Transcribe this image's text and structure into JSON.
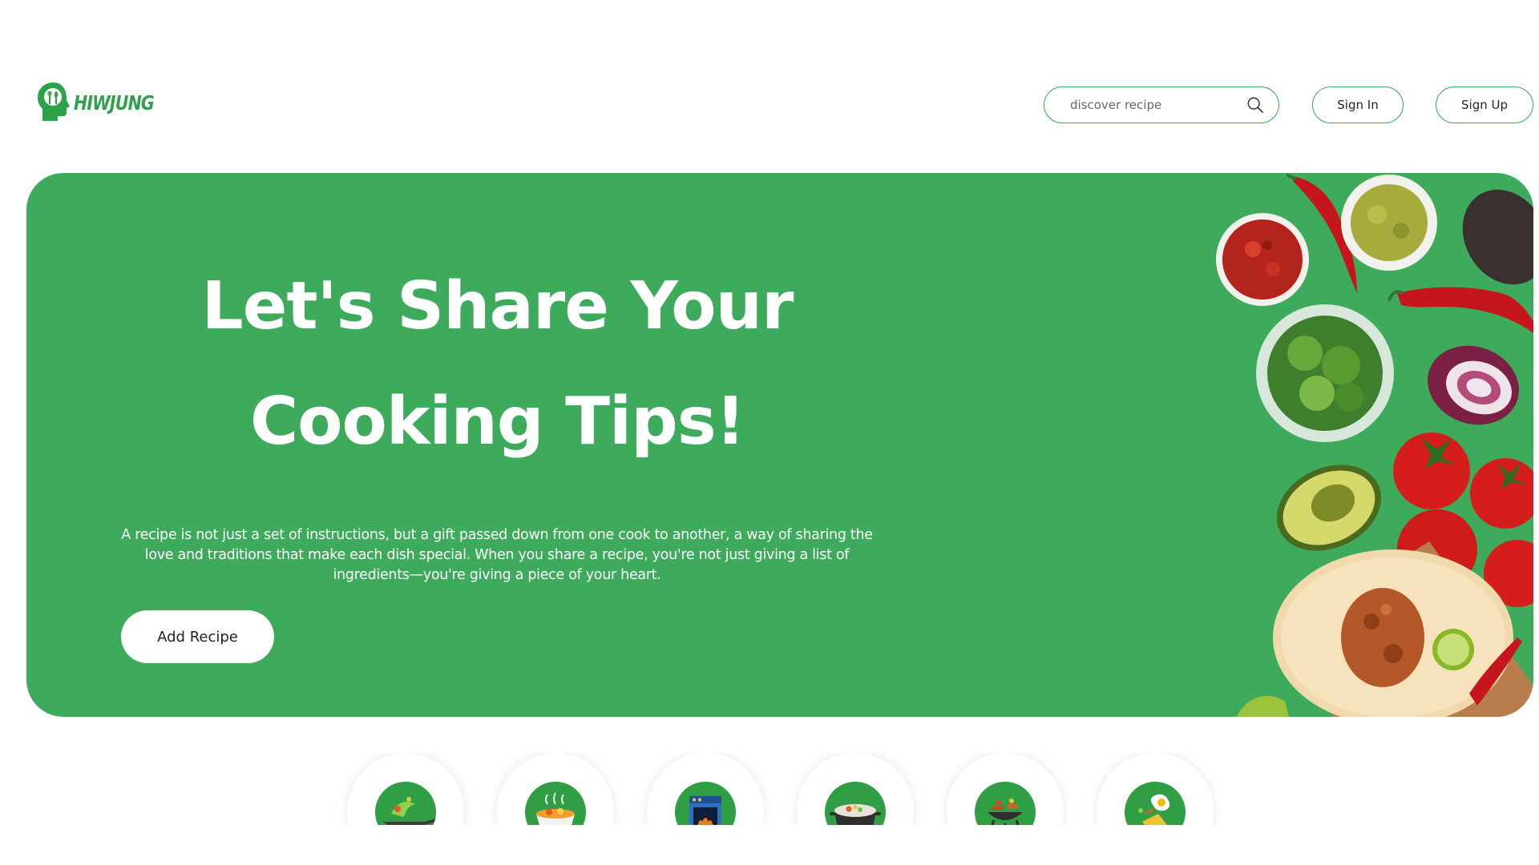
{
  "brand": {
    "name": "HIWJUNG",
    "color": "#2ea24a"
  },
  "header": {
    "search": {
      "placeholder": "discover recipe",
      "icon": "search-icon"
    },
    "sign_in_label": "Sign In",
    "sign_up_label": "Sign Up"
  },
  "hero": {
    "title_line1": "Let's Share Your",
    "title_line2": "Cooking Tips!",
    "description": "A recipe is not just a set of instructions, but a gift passed down from one cook to another, a way of sharing the love and traditions that make each dish special. When you share a recipe, you're not just giving a list of ingredients—you're giving a piece of your heart.",
    "cta_label": "Add Recipe",
    "background_color": "#3dab5b",
    "image": "fresh-ingredients-image"
  },
  "categories": [
    {
      "icon": "stir-fry-wok-icon"
    },
    {
      "icon": "steaming-dish-icon"
    },
    {
      "icon": "oven-icon"
    },
    {
      "icon": "soup-pot-icon"
    },
    {
      "icon": "grill-icon"
    },
    {
      "icon": "breakfast-egg-icon"
    }
  ]
}
